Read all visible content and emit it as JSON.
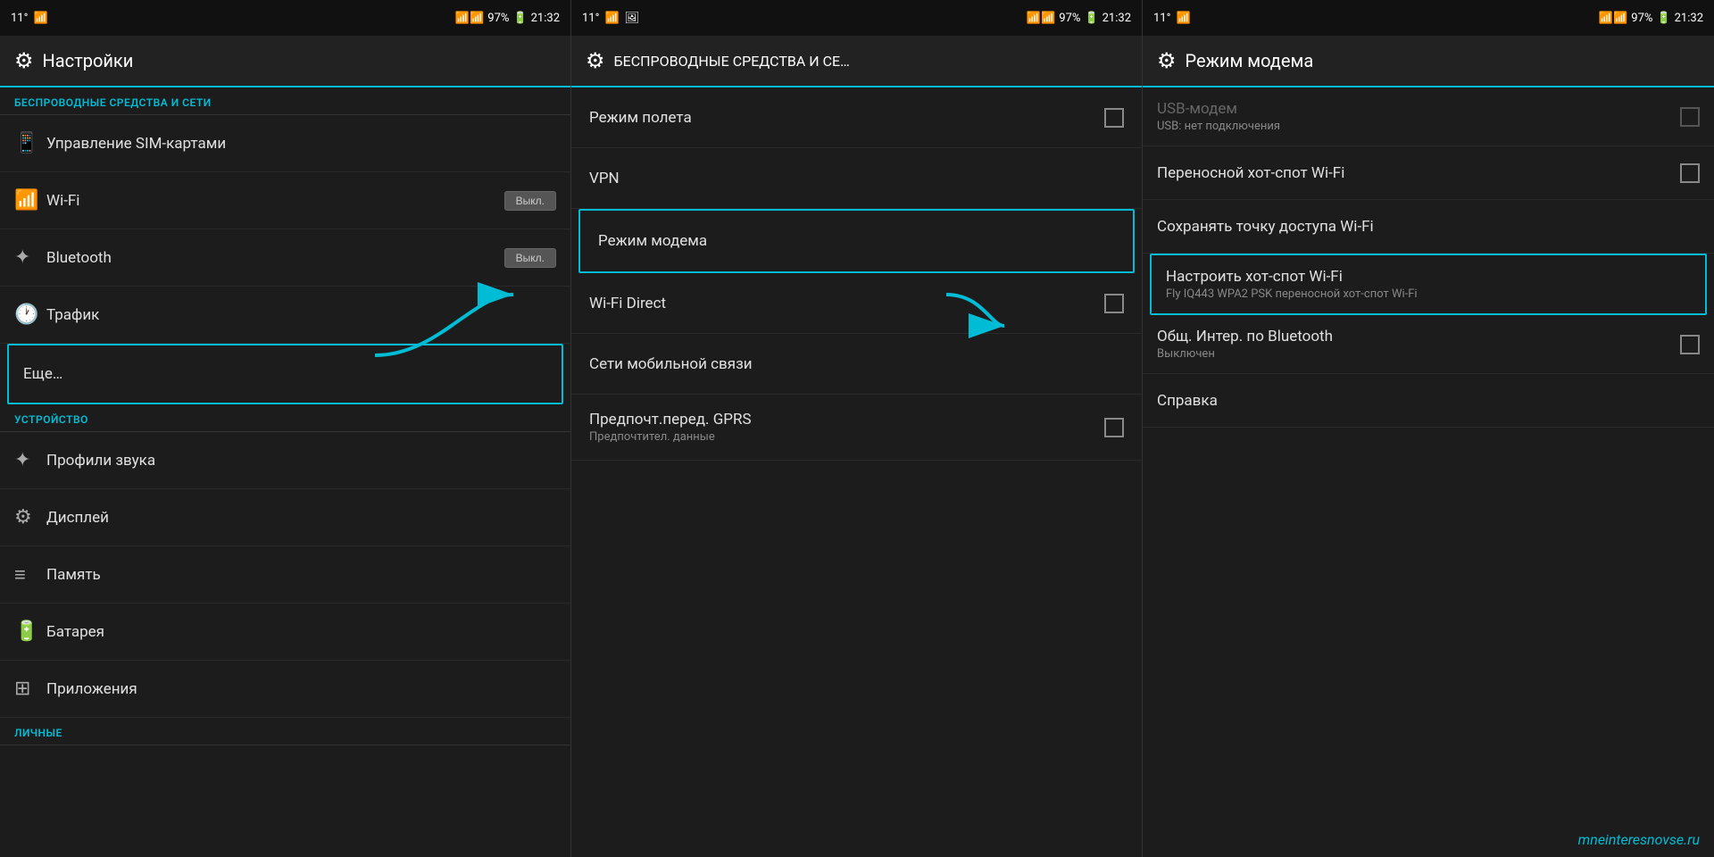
{
  "panel1": {
    "status": {
      "temp": "11°",
      "signal": "97%",
      "time": "21:32"
    },
    "header": {
      "icon": "⚙",
      "title": "Настройки"
    },
    "section1": "БЕСПРОВОДНЫЕ СРЕДСТВА И СЕТИ",
    "items": [
      {
        "id": "sim",
        "icon": "📱",
        "label": "Управление SIM-картами",
        "toggle": null
      },
      {
        "id": "wifi",
        "icon": "📶",
        "label": "Wi-Fi",
        "toggle": "Выкл."
      },
      {
        "id": "bluetooth",
        "icon": "✦",
        "label": "Bluetooth",
        "toggle": "Выкл."
      },
      {
        "id": "traffic",
        "icon": "🕐",
        "label": "Трафик",
        "toggle": null
      },
      {
        "id": "more",
        "icon": null,
        "label": "Еще…",
        "toggle": null,
        "highlight": true
      }
    ],
    "section2": "УСТРОЙСТВО",
    "device_items": [
      {
        "id": "sound",
        "icon": "✦",
        "label": "Профили звука"
      },
      {
        "id": "display",
        "icon": "⚙",
        "label": "Дисплей"
      },
      {
        "id": "memory",
        "icon": "≡",
        "label": "Память"
      },
      {
        "id": "battery",
        "icon": "🔋",
        "label": "Батарея"
      },
      {
        "id": "apps",
        "icon": "⊞",
        "label": "Приложения"
      },
      {
        "id": "personal",
        "icon": null,
        "label": "ЛИЧНЫЕ",
        "section": true
      }
    ]
  },
  "panel2": {
    "status": {
      "temp": "11°",
      "signal": "97%",
      "time": "21:32"
    },
    "header": {
      "icon": "⚙",
      "title": "БЕСПРОВОДНЫЕ СРЕДСТВА И СЕ…"
    },
    "items": [
      {
        "id": "airplane",
        "label": "Режим полета",
        "sub": null,
        "checkbox": true,
        "highlight": false
      },
      {
        "id": "vpn",
        "label": "VPN",
        "sub": null,
        "checkbox": false,
        "highlight": false
      },
      {
        "id": "modem",
        "label": "Режим модема",
        "sub": null,
        "checkbox": false,
        "highlight": true
      },
      {
        "id": "wifi_direct",
        "label": "Wi-Fi Direct",
        "sub": null,
        "checkbox": true,
        "highlight": false
      },
      {
        "id": "mobile_net",
        "label": "Сети мобильной связи",
        "sub": null,
        "checkbox": false,
        "highlight": false
      },
      {
        "id": "gprs",
        "label": "Предпочт.перед. GPRS",
        "sub": "Предпочтител. данные",
        "checkbox": true,
        "highlight": false
      }
    ]
  },
  "panel3": {
    "status": {
      "temp": "11°",
      "signal": "97%",
      "time": "21:32"
    },
    "header": {
      "icon": "⚙",
      "title": "Режим модема"
    },
    "items": [
      {
        "id": "usb",
        "label": "USB-модем",
        "sub": "USB: нет подключения",
        "checkbox": true,
        "disabled": true,
        "highlight": false
      },
      {
        "id": "hotspot_wifi",
        "label": "Переносной хот-спот Wi-Fi",
        "sub": null,
        "checkbox": true,
        "disabled": false,
        "highlight": false
      },
      {
        "id": "save_hotspot",
        "label": "Сохранять точку доступа Wi-Fi",
        "sub": null,
        "checkbox": false,
        "disabled": false,
        "highlight": false
      },
      {
        "id": "configure_hotspot",
        "label": "Настроить хот-спот Wi-Fi",
        "sub": "Fly IQ443 WPA2 PSK переносной хот-спот Wi-Fi",
        "checkbox": false,
        "disabled": false,
        "highlight": true
      },
      {
        "id": "bluetooth_tether",
        "label": "Общ. Интер. по Bluetooth",
        "sub": "Выключен",
        "checkbox": true,
        "disabled": false,
        "highlight": false
      },
      {
        "id": "help",
        "label": "Справка",
        "sub": null,
        "checkbox": false,
        "disabled": false,
        "highlight": false
      }
    ],
    "watermark": "mneinteresnovse.ru"
  },
  "toggle_off": "Выкл."
}
